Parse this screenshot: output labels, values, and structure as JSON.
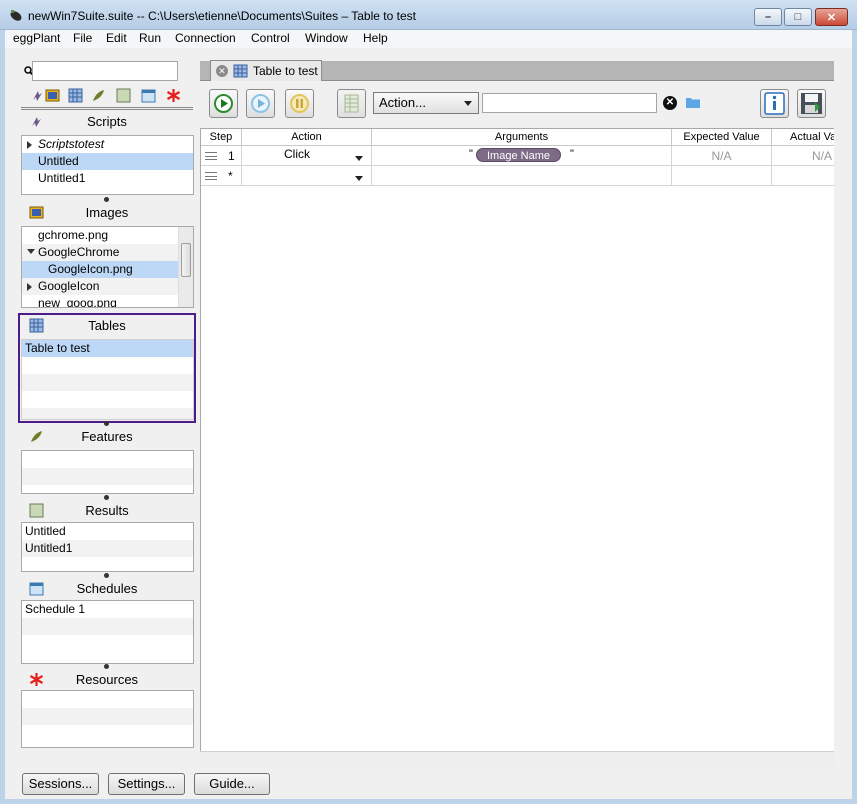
{
  "window": {
    "title": "newWin7Suite.suite -- C:\\Users\\etienne\\Documents\\Suites – Table to test",
    "min_glyph": "–",
    "max_glyph": "□",
    "close_glyph": "✕"
  },
  "menubar": [
    "eggPlant",
    "File",
    "Edit",
    "Run",
    "Connection",
    "Control",
    "Window",
    "Help"
  ],
  "sidebar": {
    "search_placeholder": "",
    "scripts": {
      "title": "Scripts",
      "items": [
        "Scriptstotest",
        "Untitled",
        "Untitled1"
      ]
    },
    "images": {
      "title": "Images",
      "items": [
        "gchrome.png",
        "GoogleChrome",
        "GoogleIcon.png",
        "GoogleIcon",
        "new_goog.png"
      ]
    },
    "tables": {
      "title": "Tables",
      "items": [
        "Table to test"
      ]
    },
    "features": {
      "title": "Features"
    },
    "results": {
      "title": "Results",
      "items": [
        "Untitled",
        "Untitled1"
      ]
    },
    "schedules": {
      "title": "Schedules",
      "items": [
        "Schedule 1"
      ]
    },
    "resources": {
      "title": "Resources"
    }
  },
  "buttons": {
    "sessions": "Sessions...",
    "settings": "Settings...",
    "guide": "Guide..."
  },
  "editor": {
    "tab_label": "Table to test",
    "action_select": "Action...",
    "argument_value": "",
    "columns": [
      "Step",
      "Action",
      "Arguments",
      "Expected Value",
      "Actual Va"
    ],
    "rows": [
      {
        "step": "1",
        "action": "Click",
        "arg_prefix": "\"",
        "arg_token": "Image Name",
        "arg_suffix": "\"",
        "expected": "N/A",
        "actual": "N/A"
      },
      {
        "step": "*",
        "action": "",
        "arg_prefix": "",
        "arg_token": "",
        "arg_suffix": "",
        "expected": "",
        "actual": ""
      }
    ]
  },
  "colors": {
    "selection": "#bcd8f6",
    "tables_highlight": "#4b1c8a",
    "token_pill": "#7c6a86"
  }
}
